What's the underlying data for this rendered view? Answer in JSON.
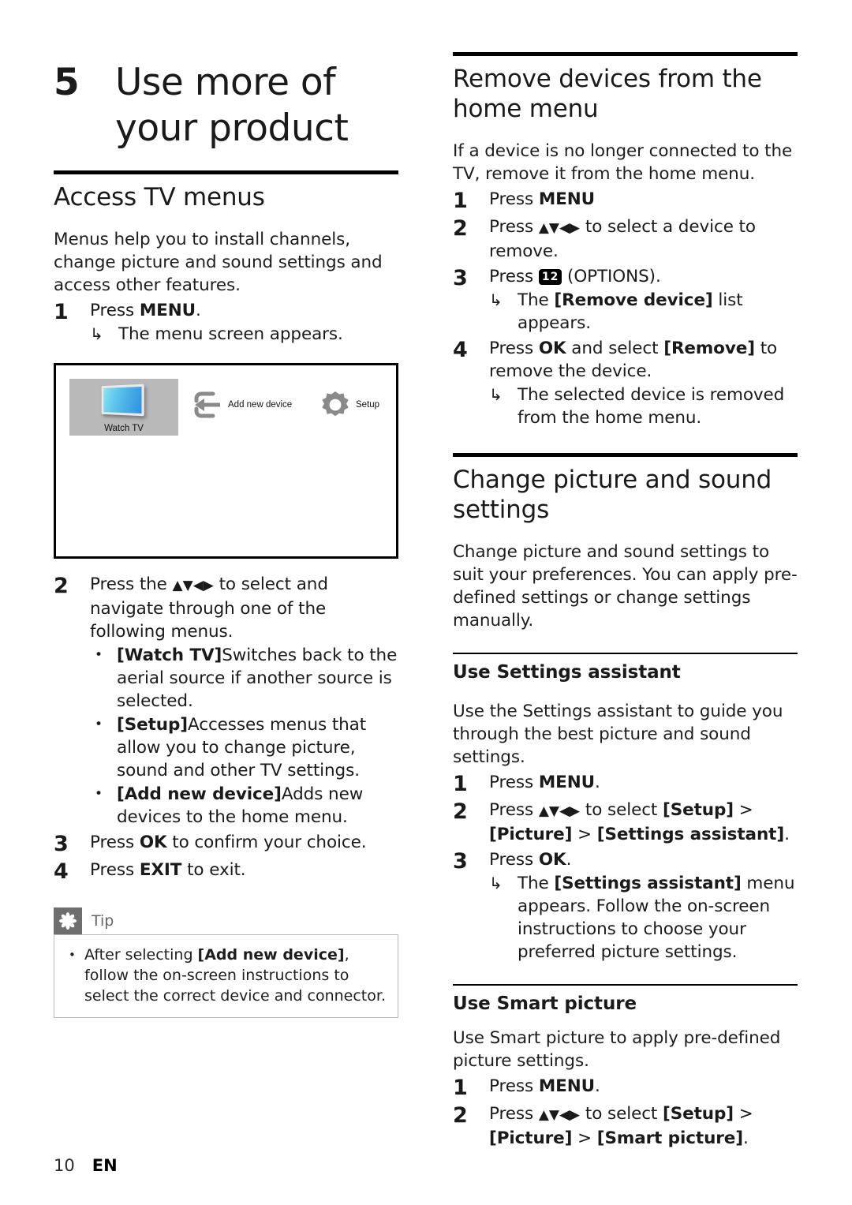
{
  "document": {
    "chapter_number": "5",
    "chapter_title_line1": "Use more of",
    "chapter_title_line2": "your product",
    "footer_page_number": "10",
    "footer_language": "EN"
  },
  "icons": {
    "nav_keys": "▲▼◀▶",
    "result_arrow": "↳",
    "bullet": "•",
    "options_key_label": "12"
  },
  "left_column": {
    "section": {
      "title": "Access TV menus",
      "intro": "Menus help you to install channels, change picture and sound settings and access other features."
    },
    "step1": {
      "num": "1",
      "text_prefix": "Press ",
      "text_bold": "MENU",
      "text_suffix": ".",
      "result": "The menu screen appears."
    },
    "figure": {
      "tv_label": "Watch TV",
      "add_device_label": "Add new device",
      "setup_label": "Setup",
      "tile_color": "#b9b9b9",
      "icon_gray": "#8a8a8a"
    },
    "step2": {
      "num": "2",
      "text_before_keys": "Press the ",
      "text_after_keys": " to select and navigate through one of the following menus.",
      "bullets": [
        {
          "bold": "[Watch TV]",
          "rest": "Switches back to the aerial source if another source is selected."
        },
        {
          "bold": "[Setup]",
          "rest": "Accesses menus that allow you to change picture, sound and other TV settings."
        },
        {
          "bold": "[Add new device]",
          "rest": "Adds new devices to the home menu."
        }
      ]
    },
    "step3": {
      "num": "3",
      "text_prefix": "Press ",
      "text_bold": "OK",
      "text_suffix": " to confirm your choice."
    },
    "step4": {
      "num": "4",
      "text_prefix": "Press ",
      "text_bold": "EXIT",
      "text_suffix": " to exit."
    },
    "tip": {
      "label": "Tip",
      "text_part1": "After selecting ",
      "text_bold": "[Add new device]",
      "text_part2": ", follow the on-screen instructions to select the correct device and connector."
    }
  },
  "right_column": {
    "remove_devices": {
      "title_line1": "Remove devices from the",
      "title_line2": "home menu",
      "intro": "If a device is no longer connected to the TV, remove it from the home menu.",
      "step1": {
        "num": "1",
        "text_prefix": "Press ",
        "text_bold": "MENU",
        "text_suffix": ""
      },
      "step2": {
        "num": "2",
        "text_before_keys": "Press ",
        "text_after_keys": " to select a device to remove."
      },
      "step3": {
        "num": "3",
        "text_prefix": "Press ",
        "text_suffix": " (OPTIONS).",
        "result_prefix": "The ",
        "result_bold": "[Remove device]",
        "result_suffix": " list appears."
      },
      "step4": {
        "num": "4",
        "text_prefix": "Press ",
        "text_bold1": "OK",
        "text_mid": " and select ",
        "text_bold2": "[Remove]",
        "text_suffix": " to remove the device.",
        "result": "The selected device is removed from the home menu."
      }
    },
    "change_settings": {
      "title_line1": "Change picture and sound",
      "title_line2": "settings",
      "intro": "Change picture and sound settings to suit your preferences. You can apply pre-defined settings or change settings manually."
    },
    "settings_assistant": {
      "title": "Use Settings assistant",
      "intro": "Use the Settings assistant to guide you through the best picture and sound settings.",
      "step1": {
        "num": "1",
        "text_prefix": "Press ",
        "text_bold": "MENU",
        "text_suffix": "."
      },
      "step2": {
        "num": "2",
        "text_before_keys": "Press ",
        "text_after_keys": " to select ",
        "bold1": "[Setup]",
        "sep1": " > ",
        "bold2": "[Picture]",
        "sep2": " > ",
        "bold3": "[Settings assistant]",
        "tail": "."
      },
      "step3": {
        "num": "3",
        "text_prefix": "Press ",
        "text_bold": "OK",
        "text_suffix": ".",
        "result_prefix": "The ",
        "result_bold": "[Settings assistant]",
        "result_suffix": " menu appears. Follow the on-screen instructions to choose your preferred picture settings."
      }
    },
    "smart_picture": {
      "title": "Use Smart picture",
      "intro": "Use Smart picture to apply pre-defined picture settings.",
      "step1": {
        "num": "1",
        "text_prefix": "Press ",
        "text_bold": "MENU",
        "text_suffix": "."
      },
      "step2": {
        "num": "2",
        "text_before_keys": "Press ",
        "text_after_keys": " to select ",
        "bold1": "[Setup]",
        "sep1": " > ",
        "bold2": "[Picture]",
        "sep2": " > ",
        "bold3": "[Smart picture]",
        "tail": "."
      }
    }
  }
}
